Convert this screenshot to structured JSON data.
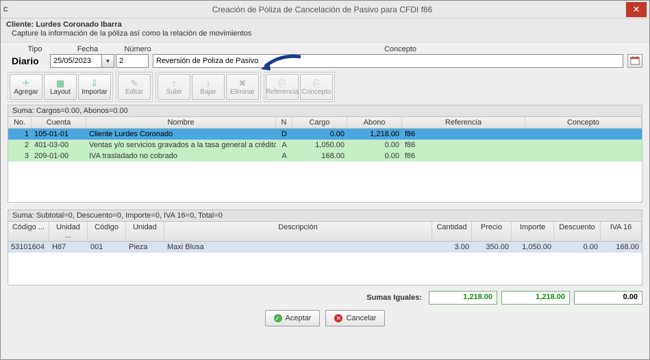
{
  "window": {
    "title": "Creación de Póliza de Cancelación de Pasivo para CFDI f86"
  },
  "client": {
    "prefix": "Cliente: ",
    "name": "Lurdes Coronado Ibarra",
    "instruction": "Capture la información de la póliza así como la relación de movimientos"
  },
  "form": {
    "labels": {
      "tipo": "Tipo",
      "fecha": "Fecha",
      "numero": "Número",
      "concepto": "Concepto"
    },
    "tipo": "Diario",
    "fecha": "25/05/2023",
    "numero": "2",
    "concepto": "Reversión de Poliza de Pasivo"
  },
  "toolbar": {
    "agregar": "Agregar",
    "layout": "Layout",
    "importar": "Importar",
    "editar": "Editar",
    "subir": "Subir",
    "bajar": "Bajar",
    "eliminar": "Eliminar",
    "referencia": "Referencia",
    "concepto": "Concepto"
  },
  "movements": {
    "summary": "Suma:  Cargos=0.00, Abonos=0.00",
    "headers": {
      "no": "No.",
      "cuenta": "Cuenta",
      "nombre": "Nombre",
      "n": "N",
      "cargo": "Cargo",
      "abono": "Abono",
      "referencia": "Referencia",
      "concepto": "Concepto"
    },
    "rows": [
      {
        "no": "1",
        "cuenta": "105-01-01",
        "nombre": "Cliente Lurdes Coronado",
        "n": "D",
        "cargo": "0.00",
        "abono": "1,218.00",
        "ref": "f86",
        "conc": ""
      },
      {
        "no": "2",
        "cuenta": "401-03-00",
        "nombre": "Ventas y/o servicios gravados a la tasa general a crédito",
        "n": "A",
        "cargo": "1,050.00",
        "abono": "0.00",
        "ref": "f86",
        "conc": ""
      },
      {
        "no": "3",
        "cuenta": "209-01-00",
        "nombre": "IVA trasladado no cobrado",
        "n": "A",
        "cargo": "168.00",
        "abono": "0.00",
        "ref": "f86",
        "conc": ""
      }
    ]
  },
  "details": {
    "summary": "Suma:  Subtotal=0, Descuento=0, Importe=0, IVA 16=0, Total=0",
    "headers": {
      "codigo_sat": "Código ...",
      "unidad_sat": "Unidad ...",
      "codigo": "Código",
      "unidad": "Unidad",
      "descripcion": "Descripción",
      "cantidad": "Cantidad",
      "precio": "Precio",
      "importe": "Importe",
      "descuento": "Descuento",
      "iva16": "IVA 16"
    },
    "rows": [
      {
        "codigo_sat": "53101604",
        "unidad_sat": "H87",
        "codigo": "001",
        "unidad": "Pieza",
        "descripcion": "Maxi Blusa",
        "cantidad": "3.00",
        "precio": "350.00",
        "importe": "1,050.00",
        "descuento": "0.00",
        "iva16": "168.00"
      }
    ]
  },
  "totals": {
    "label": "Sumas Iguales:",
    "cargo": "1,218.00",
    "abono": "1,218.00",
    "dif": "0.00"
  },
  "buttons": {
    "aceptar": "Aceptar",
    "cancelar": "Cancelar"
  }
}
